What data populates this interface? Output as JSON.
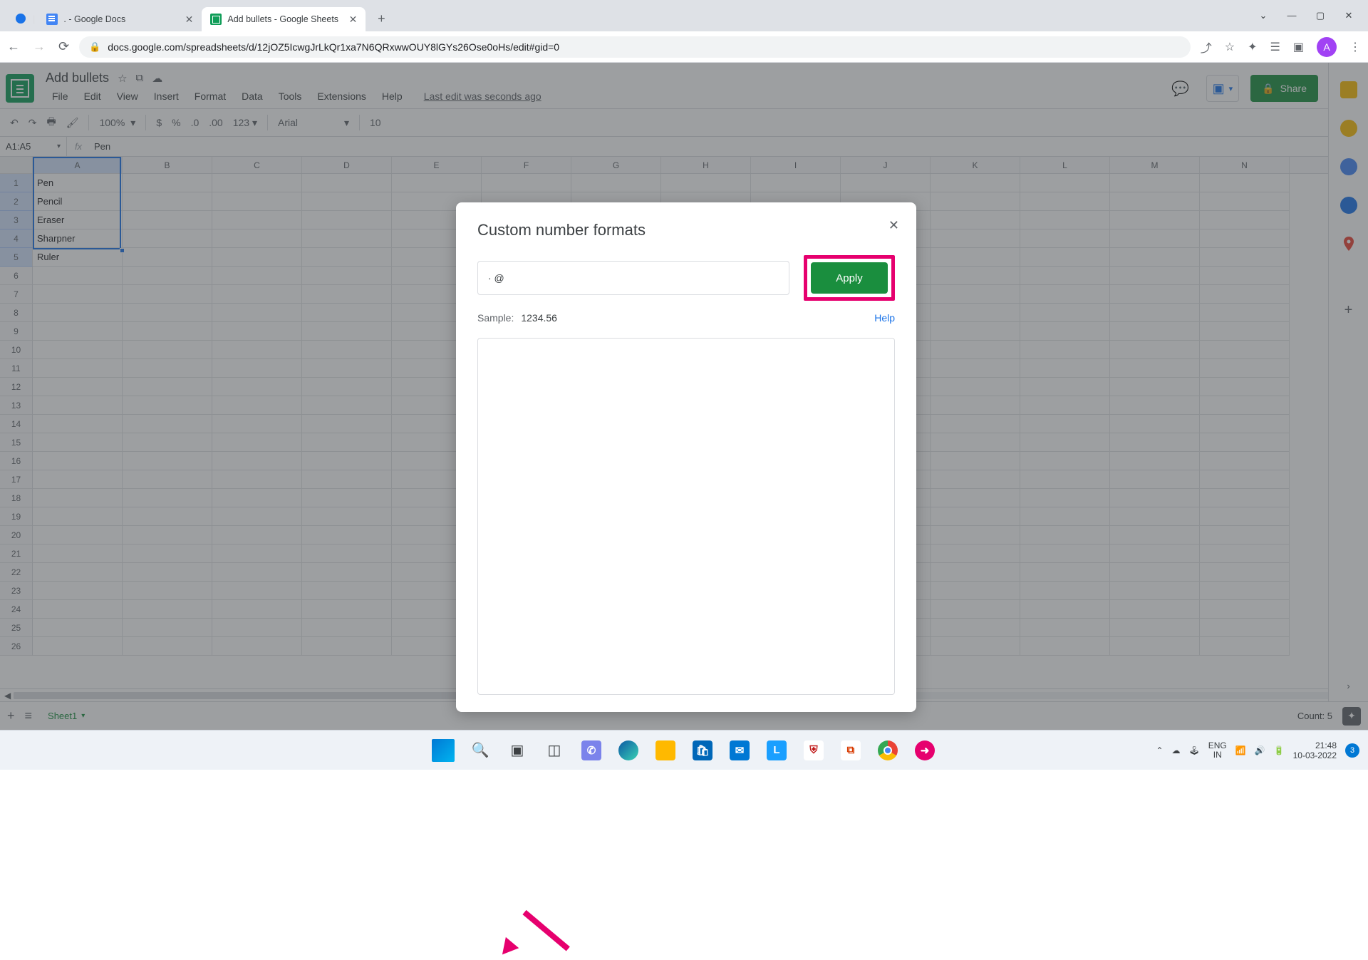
{
  "browser": {
    "tabs": [
      {
        "title": ". - Google Docs",
        "favicon": "docs"
      },
      {
        "title": "Add bullets - Google Sheets",
        "favicon": "sheets"
      }
    ],
    "url": "docs.google.com/spreadsheets/d/12jOZ5IcwgJrLkQr1xa7N6QRxwwOUY8lGYs26Ose0oHs/edit#gid=0",
    "window_controls": {
      "dropdown": "⌄",
      "min": "—",
      "max": "▢",
      "close": "✕"
    }
  },
  "sheets": {
    "doc_title": "Add bullets",
    "title_icons": [
      "☆",
      "⧉",
      "☁"
    ],
    "menubar": [
      "File",
      "Edit",
      "View",
      "Insert",
      "Format",
      "Data",
      "Tools",
      "Extensions",
      "Help"
    ],
    "last_edit": "Last edit was seconds ago",
    "share_label": "Share",
    "avatar_letter": "A",
    "toolbar": {
      "zoom": "100%",
      "font": "Arial",
      "fontsize": "10",
      "number_fmt": "123"
    },
    "namebox": "A1:A5",
    "fx_value": "Pen",
    "columns": [
      "A",
      "B",
      "C",
      "D",
      "E",
      "F",
      "G",
      "H",
      "I",
      "J",
      "K",
      "L",
      "M",
      "N"
    ],
    "cells_col_a": [
      "Pen",
      "Pencil",
      "Eraser",
      "Sharpner",
      "Ruler"
    ],
    "row_count": 26,
    "sheet_tab": "Sheet1",
    "footer_count": "Count: 5"
  },
  "modal": {
    "title": "Custom number formats",
    "input_value": "· @",
    "apply_label": "Apply",
    "sample_label": "Sample:",
    "sample_value": "1234.56",
    "help_label": "Help"
  },
  "taskbar": {
    "lang_top": "ENG",
    "lang_bot": "IN",
    "time": "21:48",
    "date": "10-03-2022",
    "notif_count": "3"
  }
}
